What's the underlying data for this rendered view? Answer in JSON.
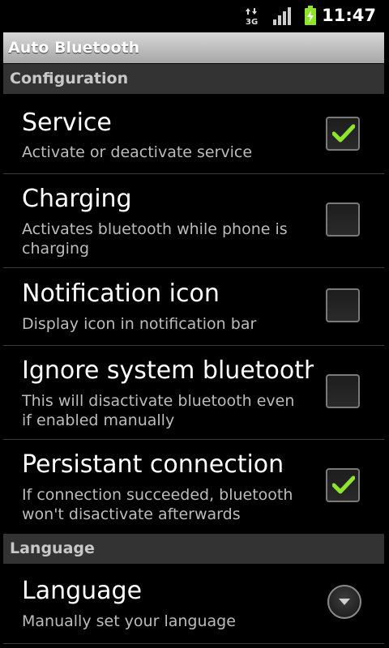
{
  "status_bar": {
    "network_label": "3G",
    "time": "11:47"
  },
  "title": "Auto Bluetooth",
  "categories": [
    {
      "label": "Configuration",
      "items": [
        {
          "title": "Service",
          "summary": "Activate or deactivate service",
          "checked": true
        },
        {
          "title": "Charging",
          "summary": "Activates bluetooth while phone is charging",
          "checked": false
        },
        {
          "title": "Notification icon",
          "summary": "Display icon in notification bar",
          "checked": false
        },
        {
          "title": "Ignore system bluetooth s",
          "summary": "This will disactivate bluetooth even if enabled manually",
          "checked": false
        },
        {
          "title": "Persistant connection",
          "summary": "If connection succeeded, bluetooth won't disactivate afterwards",
          "checked": true
        }
      ]
    },
    {
      "label": "Language",
      "items": [
        {
          "title": "Language",
          "summary": "Manually set your language",
          "widget": "dropdown"
        }
      ]
    }
  ],
  "colors": {
    "accent_check": "#8fe52b",
    "category_bg": "#333333",
    "titlebar_bg": "#bdbdbd"
  }
}
